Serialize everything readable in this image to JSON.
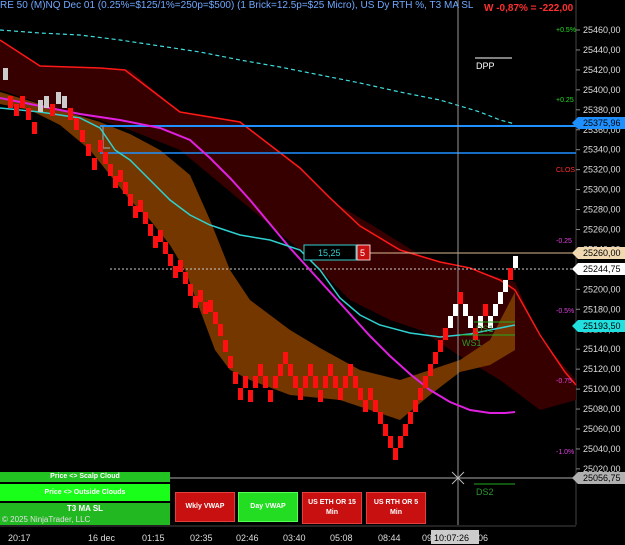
{
  "header": {
    "title": "RE 50 (M)NQ Dec 01 (0.25%=$125/1%=250p=$500)  (1 Brick=12.5p=$25 Micro), US Dy RTH %, T3 MA SL",
    "pnl": "W -0,87% = -222,00"
  },
  "price_axis": {
    "ticks": [
      "25460,00",
      "25440,00",
      "25420,00",
      "25400,00",
      "25380,00",
      "25360,00",
      "25340,00",
      "25320,00",
      "25300,00",
      "25280,00",
      "25260,00",
      "25240,00",
      "25220,00",
      "25200,00",
      "25180,00",
      "25160,00",
      "25140,00",
      "25120,00",
      "25100,00",
      "25080,00",
      "25060,00",
      "25040,00",
      "25020,00"
    ],
    "boxes": [
      {
        "label": "25375,96",
        "bg": "#1e90ff",
        "fg": "#000000"
      },
      {
        "label": "25260,00",
        "bg": "#f0d8b0",
        "fg": "#000000"
      },
      {
        "label": "25244,75",
        "bg": "#ffffff",
        "fg": "#000000"
      },
      {
        "label": "25193,50",
        "bg": "#22e0e0",
        "fg": "#000000"
      },
      {
        "label": "25056,75",
        "bg": "#b0b0b0",
        "fg": "#000000"
      }
    ]
  },
  "time_axis": {
    "labels": [
      "20:17",
      "16 dec",
      "01:15",
      "02:35",
      "02:46",
      "03:40",
      "05:08",
      "08:44",
      "09",
      "10:07:26",
      "06"
    ]
  },
  "annotations": {
    "dpp": "DPP",
    "close": "CLOS",
    "ds1": "DS1",
    "ws1": "WS1",
    "ds2": "DS2",
    "pct": [
      "+0.5%",
      "+0.25",
      "-0.25",
      "-0.5%",
      "-0.75",
      "-1.0%"
    ]
  },
  "order": {
    "price": "15,25",
    "qty": "5"
  },
  "buttons": {
    "scalp_cloud": "Price <> Scalp Cloud",
    "outside_clouds": "Price <> Outside Clouds",
    "t3_ma_sl": "T3 MA SL",
    "copyright": "© 2025 NinjaTrader, LLC",
    "wkly_vwap": "Wkly VWAP",
    "day_vwap": "Day VWAP",
    "us_eth": "US ETH OR 15 Min",
    "us_rth": "US RTH OR 5 Min"
  },
  "colors": {
    "up_brick": "#ffffff",
    "down_brick": "#ff1010",
    "cloud_red": "#3a0000",
    "cloud_orange": "#7a3a00",
    "cyan_line": "#2fd0d0",
    "magenta_line": "#e020e0",
    "blue_line": "#1e90ff"
  }
}
